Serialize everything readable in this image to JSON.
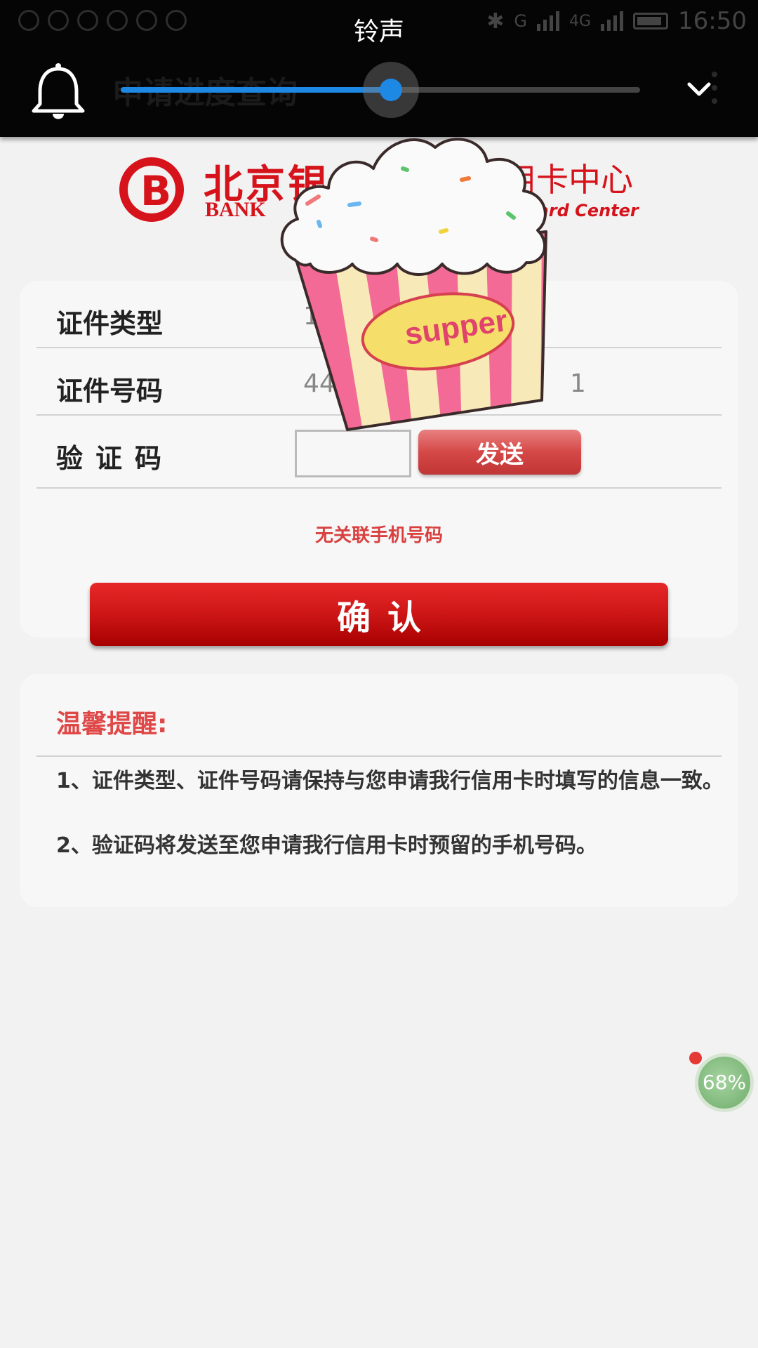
{
  "status_bar": {
    "carrier_signal": "G",
    "network": "4G",
    "time": "16:50"
  },
  "volume_overlay": {
    "title": "铃声",
    "icon": "bell-icon",
    "level": 0.52,
    "accent": "#1e88e5"
  },
  "header": {
    "title": "申请进度查询",
    "close_icon": "close-icon",
    "menu_icon": "more-vert-icon"
  },
  "logo": {
    "mark": "B",
    "cn_left": "北京银",
    "en_left": "BANK",
    "cn_right": "用卡中心",
    "en_right": "Card Center",
    "color": "#d6121b"
  },
  "form": {
    "id_type_label": "证件类型",
    "id_type_value": "18",
    "id_number_label": "证件号码",
    "id_number_value_start": "441",
    "id_number_value_end": "1",
    "verify_label": "验证码",
    "send_button": "发送",
    "no_phone_message": "无关联手机号码",
    "confirm_button": "确认"
  },
  "tips": {
    "title": "温馨提醒:",
    "items": [
      "1、证件类型、证件号码请保持与您申请我行信用卡时填写的信息一致。",
      "2、验证码将发送至您申请我行信用卡时预留的手机号码。"
    ]
  },
  "sticker": {
    "label": "supper"
  },
  "memory_ball": {
    "percent": "68%"
  },
  "colors": {
    "brand_red": "#d6121b",
    "confirm_red": "#d01818",
    "tip_red": "#e04848",
    "background": "#f2f2f2"
  }
}
